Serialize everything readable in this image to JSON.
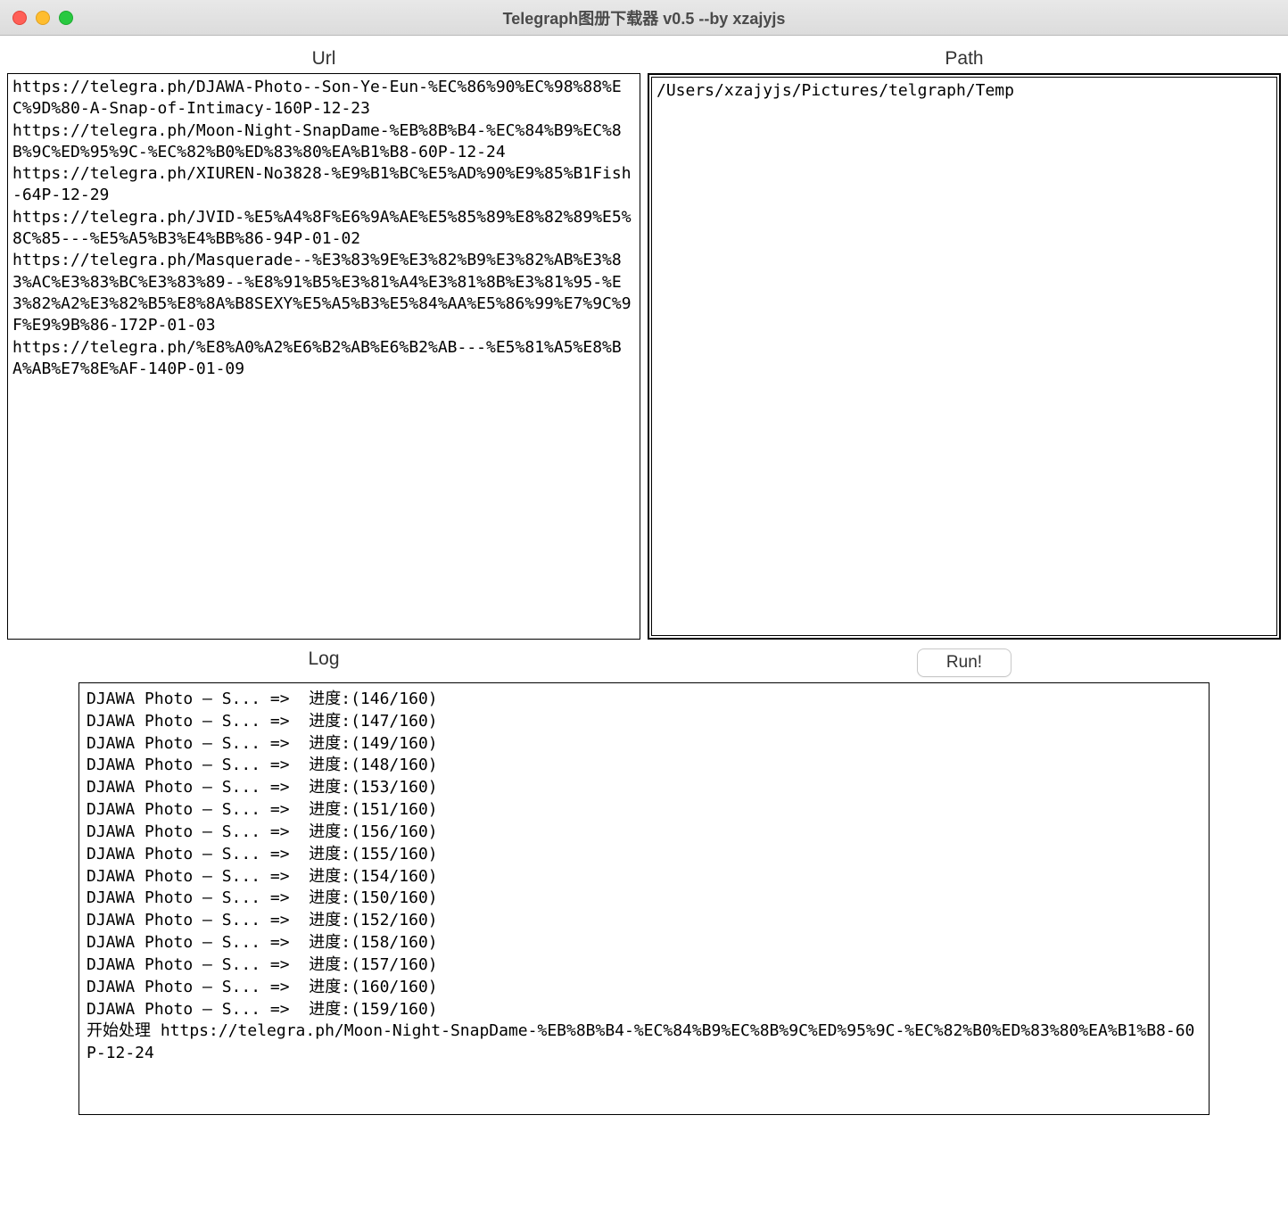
{
  "window": {
    "title": "Telegraph图册下载器 v0.5 --by xzajyjs"
  },
  "labels": {
    "url": "Url",
    "path": "Path",
    "log": "Log",
    "run": "Run!"
  },
  "inputs": {
    "url_value": "https://telegra.ph/DJAWA-Photo--Son-Ye-Eun-%EC%86%90%EC%98%88%EC%9D%80-A-Snap-of-Intimacy-160P-12-23\nhttps://telegra.ph/Moon-Night-SnapDame-%EB%8B%B4-%EC%84%B9%EC%8B%9C%ED%95%9C-%EC%82%B0%ED%83%80%EA%B1%B8-60P-12-24\nhttps://telegra.ph/XIUREN-No3828-%E9%B1%BC%E5%AD%90%E9%85%B1Fish-64P-12-29\nhttps://telegra.ph/JVID-%E5%A4%8F%E6%9A%AE%E5%85%89%E8%82%89%E5%8C%85---%E5%A5%B3%E4%BB%86-94P-01-02\nhttps://telegra.ph/Masquerade--%E3%83%9E%E3%82%B9%E3%82%AB%E3%83%AC%E3%83%BC%E3%83%89--%E8%91%B5%E3%81%A4%E3%81%8B%E3%81%95-%E3%82%A2%E3%82%B5%E8%8A%B8SEXY%E5%A5%B3%E5%84%AA%E5%86%99%E7%9C%9F%E9%9B%86-172P-01-03\nhttps://telegra.ph/%E8%A0%A2%E6%B2%AB%E6%B2%AB---%E5%81%A5%E8%BA%AB%E7%8E%AF-140P-01-09",
    "path_value": "/Users/xzajyjs/Pictures/telgraph/Temp"
  },
  "log": {
    "lines": [
      "DJAWA Photo – S... =>  进度:(146/160)",
      "DJAWA Photo – S... =>  进度:(147/160)",
      "DJAWA Photo – S... =>  进度:(149/160)",
      "DJAWA Photo – S... =>  进度:(148/160)",
      "DJAWA Photo – S... =>  进度:(153/160)",
      "DJAWA Photo – S... =>  进度:(151/160)",
      "DJAWA Photo – S... =>  进度:(156/160)",
      "DJAWA Photo – S... =>  进度:(155/160)",
      "DJAWA Photo – S... =>  进度:(154/160)",
      "DJAWA Photo – S... =>  进度:(150/160)",
      "DJAWA Photo – S... =>  进度:(152/160)",
      "DJAWA Photo – S... =>  进度:(158/160)",
      "DJAWA Photo – S... =>  进度:(157/160)",
      "DJAWA Photo – S... =>  进度:(160/160)",
      "DJAWA Photo – S... =>  进度:(159/160)",
      "开始处理 https://telegra.ph/Moon-Night-SnapDame-%EB%8B%B4-%EC%84%B9%EC%8B%9C%ED%95%9C-%EC%82%B0%ED%83%80%EA%B1%B8-60P-12-24"
    ]
  }
}
